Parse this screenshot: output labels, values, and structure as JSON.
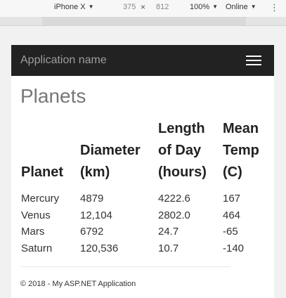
{
  "devtools": {
    "device": "iPhone X",
    "width": "375",
    "times": "×",
    "height": "812",
    "zoom": "100%",
    "network": "Online",
    "more": "⋮"
  },
  "navbar": {
    "brand": "Application name",
    "toggle_icon": "hamburger-menu-icon"
  },
  "page": {
    "title": "Planets"
  },
  "table": {
    "headers": [
      "Planet",
      "Diameter (km)",
      "Length of Day (hours)",
      "Mean Temp (C)"
    ],
    "rows": [
      [
        "Mercury",
        "4879",
        "4222.6",
        "167"
      ],
      [
        "Venus",
        "12,104",
        "2802.0",
        "464"
      ],
      [
        "Mars",
        "6792",
        "24.7",
        "-65"
      ],
      [
        "Saturn",
        "120,536",
        "10.7",
        "-140"
      ]
    ]
  },
  "footer": {
    "text": "© 2018 - My ASP.NET Application"
  }
}
